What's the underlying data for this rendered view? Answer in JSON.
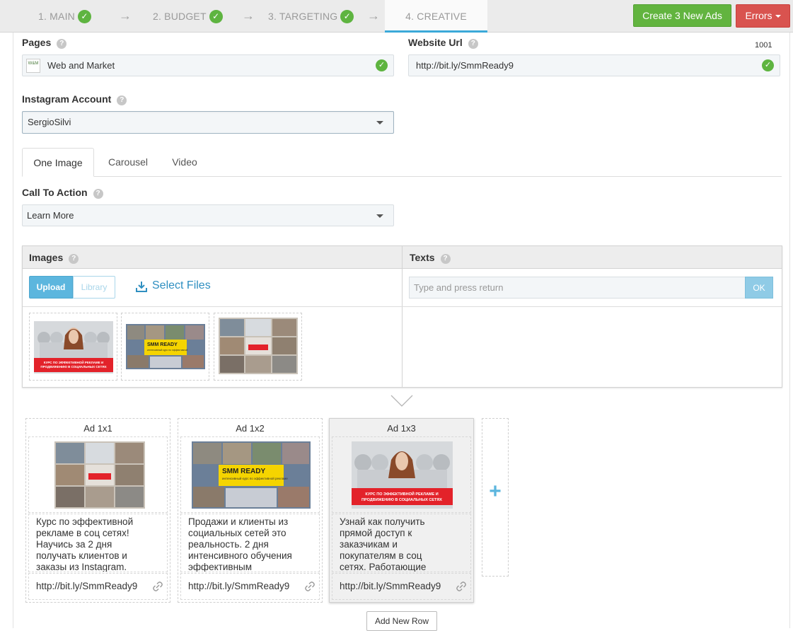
{
  "steps": [
    {
      "label": "1. MAIN",
      "done": true
    },
    {
      "label": "2. BUDGET",
      "done": true
    },
    {
      "label": "3. TARGETING",
      "done": true
    },
    {
      "label": "4. CREATIVE",
      "done": false
    }
  ],
  "header": {
    "create_label": "Create 3 New Ads",
    "errors_label": "Errors"
  },
  "form": {
    "pages_label": "Pages",
    "pages_value": "Web and Market",
    "website_label": "Website Url",
    "website_value": "http://bit.ly/SmmReady9",
    "website_count": "1001",
    "instagram_label": "Instagram Account",
    "instagram_value": "SergioSilvi",
    "help_glyph": "?",
    "cta_label": "Call To Action",
    "cta_value": "Learn More"
  },
  "tabs": [
    "One Image",
    "Carousel",
    "Video"
  ],
  "panel": {
    "images_label": "Images",
    "texts_label": "Texts",
    "upload_label": "Upload",
    "library_label": "Library",
    "select_files_label": "Select Files",
    "texts_placeholder": "Type and press return",
    "ok_label": "OK",
    "thumb_caption_1": "КУРС ПО ЭФФЕКТИВНОЙ РЕКЛАМЕ И ПРОДВИЖЕНИЮ В СОЦИАЛЬНЫХ СЕТЯХ",
    "thumb_caption_2": "SMM READY"
  },
  "ads": [
    {
      "title": "Ad 1x1",
      "text": "Курс по эффективной\nрекламе в соц сетях!\nНаучись за 2 дня\nполучать клиентов и\nзаказы из Instagram.",
      "url": "http://bit.ly/SmmReady9"
    },
    {
      "title": "Ad 1x2",
      "text": "Продажи и клиенты из\nсоциальных сетей это\nреальность. 2 дня\nинтенсивного обучения\nэффективным",
      "url": "http://bit.ly/SmmReady9",
      "img_caption": "SMM READY"
    },
    {
      "title": "Ad 1x3",
      "text": "Узнай как получить\nпрямой доступ к\nзаказчикам и\nпокупателям в соц\nсетях. Работающие",
      "url": "http://bit.ly/SmmReady9",
      "img_caption": "КУРС ПО ЭФФЕКТИВНОЙ РЕКЛАМЕ И ПРОДВИЖЕНИЮ В СОЦИАЛЬНЫХ СЕТЯХ"
    }
  ],
  "add_column_label": "+",
  "add_row_label": "Add New Row",
  "icons": {
    "step_done": "checkmark-icon",
    "step_arrow": "arrow-right-icon",
    "link": "link-icon",
    "download": "download-icon",
    "help": "help-icon",
    "chevron": "chevron-down-icon"
  },
  "colors": {
    "green": "#62b43f",
    "red": "#d9534f",
    "blue": "#5cb6de",
    "link_blue": "#2f8fc1"
  }
}
